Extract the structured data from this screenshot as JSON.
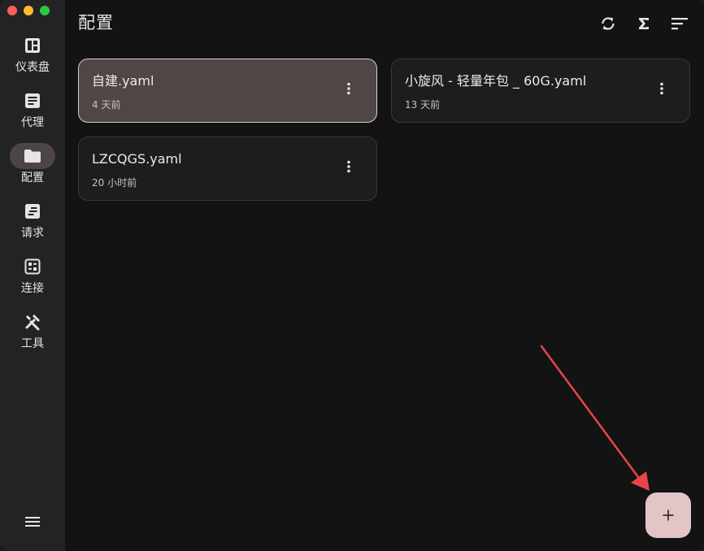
{
  "window": {
    "traffic_lights": [
      "#ff5f57",
      "#febc2e",
      "#28c840"
    ]
  },
  "page": {
    "title": "配置"
  },
  "sidebar": {
    "items": [
      {
        "label": "仪表盘",
        "icon": "dashboard-icon",
        "active": false
      },
      {
        "label": "代理",
        "icon": "article-icon",
        "active": false
      },
      {
        "label": "配置",
        "icon": "folder-icon",
        "active": true
      },
      {
        "label": "请求",
        "icon": "request-list-icon",
        "active": false
      },
      {
        "label": "连接",
        "icon": "connections-icon",
        "active": false
      },
      {
        "label": "工具",
        "icon": "tools-icon",
        "active": false
      }
    ],
    "menu_icon": "hamburger-menu-icon"
  },
  "toolbar": {
    "icons": [
      "sync-icon",
      "sigma-icon",
      "sort-icon"
    ]
  },
  "profiles": [
    {
      "name": "自建.yaml",
      "time": "4 天前",
      "selected": true
    },
    {
      "name": "小旋风 - 轻量年包 _ 60G.yaml",
      "time": "13 天前",
      "selected": false
    },
    {
      "name": "LZCQGS.yaml",
      "time": "20 小时前",
      "selected": false
    }
  ],
  "fab": {
    "label": "+"
  },
  "colors": {
    "background": "#131313",
    "sidebar": "#232326",
    "active_pill": "#4d4545",
    "selected_card": "#4f4646",
    "fab": "#e3c5c7",
    "annotation_arrow": "#e8454a"
  }
}
